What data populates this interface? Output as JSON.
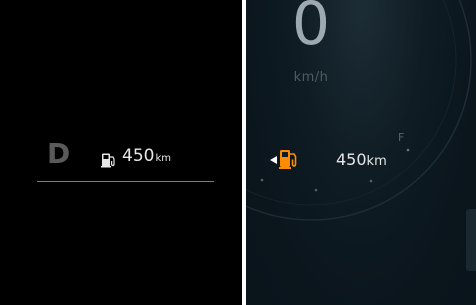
{
  "left_panel": {
    "gear": "D",
    "range_value": "450",
    "range_unit": "km",
    "icons": {
      "fuel": "fuel-pump-icon"
    }
  },
  "right_panel": {
    "speed_value": "0",
    "speed_unit": "km/h",
    "fuel_full_label": "F",
    "range_value": "450",
    "range_unit": "km",
    "icons": {
      "fuel": "fuel-pump-icon",
      "arrow": "warning-arrow-icon"
    },
    "colors": {
      "fuel_warning": "#ff8c00"
    }
  }
}
